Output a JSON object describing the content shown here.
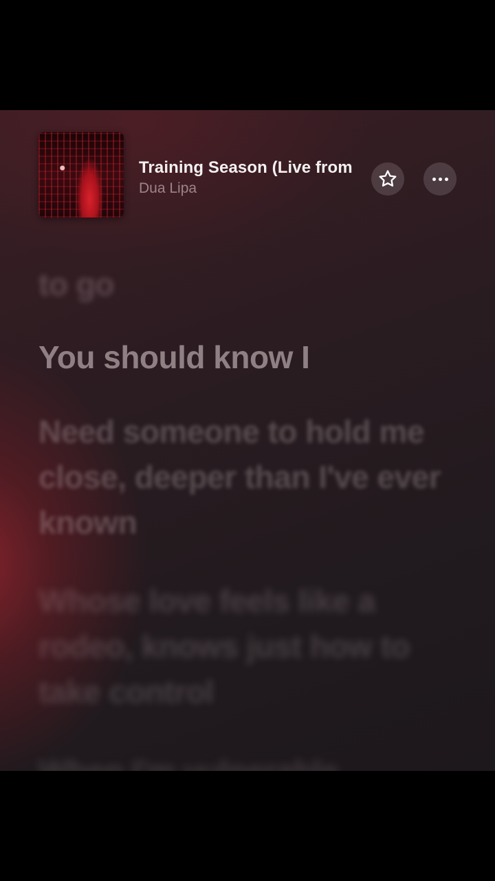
{
  "now_playing": {
    "title": "Training Season (Live from",
    "artist": "Dua Lipa",
    "artwork_icon": "album-artwork",
    "favorite_icon": "star-icon",
    "more_icon": "more-icon"
  },
  "lyrics": {
    "previous_line": "to go",
    "active_line": "You should know I",
    "upcoming_lines": [
      "Need someone to hold me close, deeper than I've ever known",
      "Whose love feels like a rodeo, knows just how to take control",
      "When I'm vulnerable"
    ]
  },
  "colors": {
    "background": "#2a1c21",
    "accent_red": "#961f2b",
    "title_text": "#f4f0f1"
  }
}
